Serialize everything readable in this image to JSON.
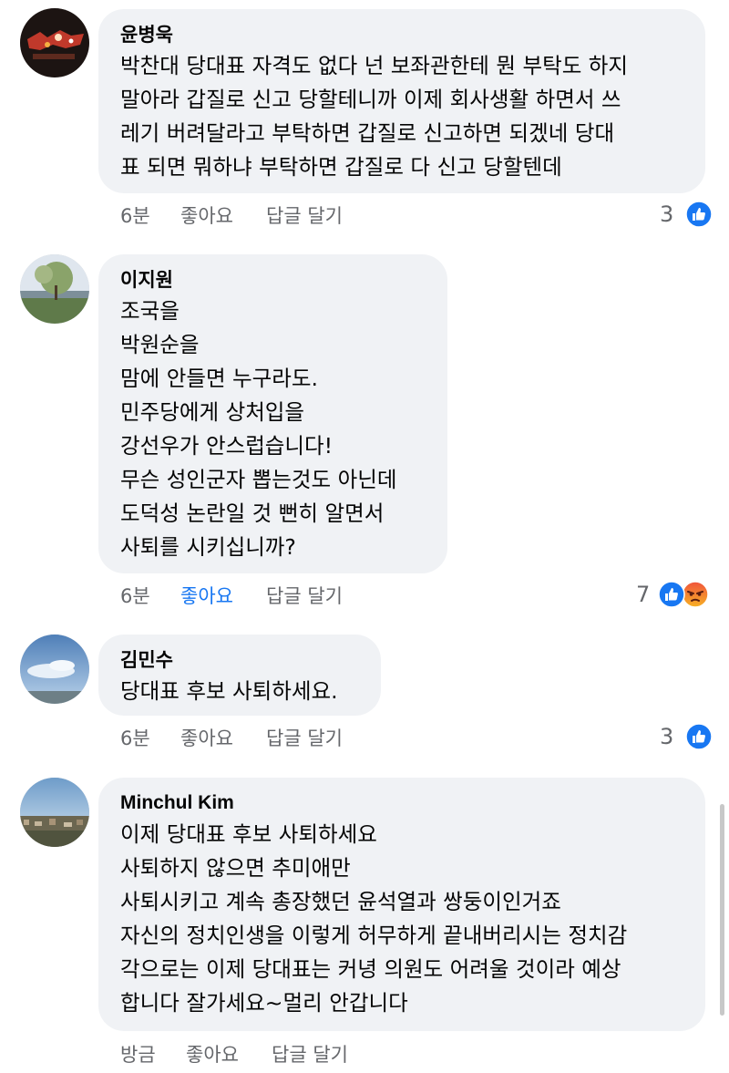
{
  "comments": [
    {
      "author": "윤병욱",
      "lines": [
        "박찬대 당대표 자격도 없다 넌 보좌관한테 뭔 부탁도 하지",
        "말아라 갑질로 신고 당할테니까 이제 회사생활 하면서 쓰",
        "레기 버려달라고 부탁하면 갑질로 신고하면 되겠네 당대",
        "표 되면 뭐하냐 부탁하면 갑질로 다 신고 당할텐데"
      ],
      "time": "6분",
      "like_label": "좋아요",
      "reply_label": "답글 달기",
      "reaction_count": "3",
      "reactions": [
        "like-icon"
      ]
    },
    {
      "author": "이지원",
      "lines": [
        "조국을",
        "박원순을",
        "맘에 안들면 누구라도.",
        "민주당에게 상처입을",
        "강선우가 안스럽습니다!",
        "무슨 성인군자 뽑는것도 아닌데",
        "도덕성 논란일 것 뻔히 알면서",
        "사퇴를 시키십니까?"
      ],
      "time": "6분",
      "like_label": "좋아요",
      "reply_label": "답글 달기",
      "reaction_count": "7",
      "reactions": [
        "like-icon",
        "angry-icon"
      ],
      "liked": true
    },
    {
      "author": "김민수",
      "lines": [
        "당대표 후보 사퇴하세요."
      ],
      "time": "6분",
      "like_label": "좋아요",
      "reply_label": "답글 달기",
      "reaction_count": "3",
      "reactions": [
        "like-icon"
      ]
    },
    {
      "author": "Minchul Kim",
      "lines": [
        "이제 당대표 후보 사퇴하세요",
        "사퇴하지 않으면 추미애만",
        "사퇴시키고 계속 총장했던 윤석열과 쌍둥이인거죠",
        "자신의 정치인생을 이렇게 허무하게 끝내버리시는 정치감",
        "각으로는 이제 당대표는 커녕 의원도 어려울 것이라 예상",
        "합니다 잘가세요~멀리 안갑니다"
      ],
      "time": "방금",
      "like_label": "좋아요",
      "reply_label": "답글 달기"
    }
  ],
  "colors": {
    "bubble": "#f0f2f5",
    "meta_text": "#65676b",
    "like_blue": "#1877f2",
    "angry_orange": "#f0543c"
  }
}
